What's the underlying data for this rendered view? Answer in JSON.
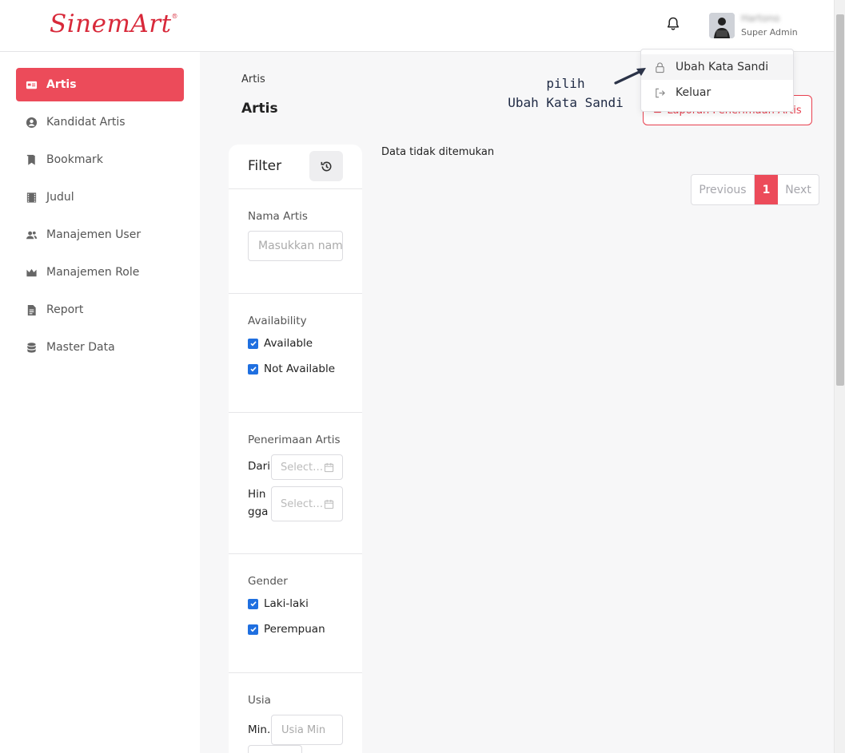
{
  "header": {
    "brand": "SinemArt",
    "brand_mark": "®",
    "user_name": "Hartono",
    "user_role": "Super Admin"
  },
  "sidebar": {
    "items": [
      {
        "label": "Artis",
        "icon": "id-card-icon",
        "active": true
      },
      {
        "label": "Kandidat Artis",
        "icon": "user-circle-icon",
        "active": false
      },
      {
        "label": "Bookmark",
        "icon": "bookmark-icon",
        "active": false
      },
      {
        "label": "Judul",
        "icon": "film-icon",
        "active": false
      },
      {
        "label": "Manajemen User",
        "icon": "users-icon",
        "active": false
      },
      {
        "label": "Manajemen Role",
        "icon": "crown-icon",
        "active": false
      },
      {
        "label": "Report",
        "icon": "document-icon",
        "active": false
      },
      {
        "label": "Master Data",
        "icon": "database-icon",
        "active": false
      }
    ]
  },
  "main": {
    "breadcrumb": "Artis",
    "title": "Artis",
    "report_button": "Laporan Penerimaan Artis",
    "empty_message": "Data tidak ditemukan",
    "pagination": {
      "previous": "Previous",
      "current": "1",
      "next": "Next"
    }
  },
  "user_menu": {
    "items": [
      {
        "label": "Ubah Kata Sandi",
        "icon": "lock-icon"
      },
      {
        "label": "Keluar",
        "icon": "logout-icon"
      }
    ]
  },
  "annotation": {
    "line1": "pilih",
    "line2": "Ubah Kata Sandi"
  },
  "filter": {
    "title": "Filter",
    "nama_artis": {
      "label": "Nama Artis",
      "placeholder": "Masukkan nama"
    },
    "availability": {
      "label": "Availability",
      "options": [
        {
          "label": "Available",
          "checked": true
        },
        {
          "label": "Not Available",
          "checked": true
        }
      ]
    },
    "penerimaan": {
      "label": "Penerimaan Artis",
      "from_label": "Dari",
      "to_label_1": "Hin",
      "to_label_2": "gga",
      "from_placeholder": "Select date",
      "to_placeholder": "Select date"
    },
    "gender": {
      "label": "Gender",
      "options": [
        {
          "label": "Laki-laki",
          "checked": true
        },
        {
          "label": "Perempuan",
          "checked": true
        }
      ]
    },
    "usia": {
      "label": "Usia",
      "min_label": "Min.",
      "min_placeholder": "Usia Min"
    }
  },
  "colors": {
    "accent": "#ec4b5a",
    "brand": "#d8293a",
    "checkbox": "#1f6fe0"
  }
}
